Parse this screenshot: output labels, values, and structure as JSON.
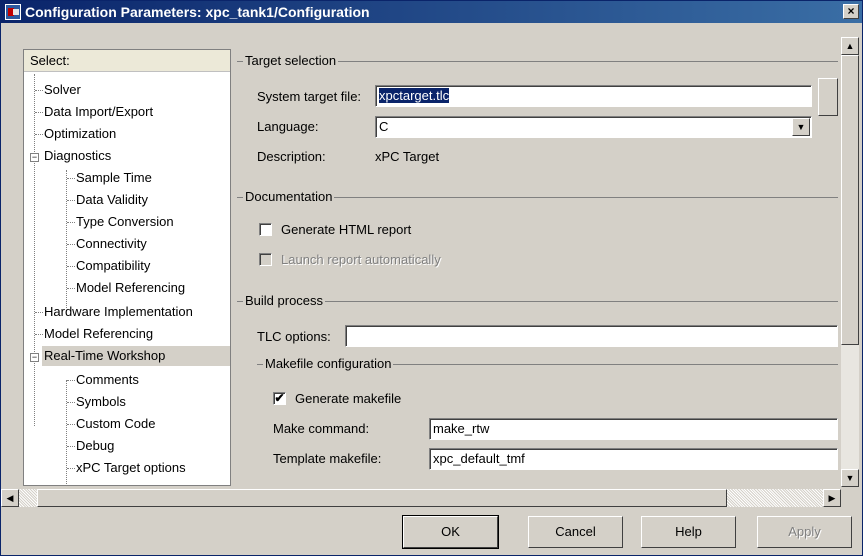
{
  "window": {
    "title": "Configuration Parameters: xpc_tank1/Configuration",
    "close_label": "×"
  },
  "tree": {
    "header": "Select:",
    "items": [
      {
        "label": "Solver"
      },
      {
        "label": "Data Import/Export"
      },
      {
        "label": "Optimization"
      },
      {
        "label": "Diagnostics",
        "expander": "−"
      },
      {
        "label": "Sample Time"
      },
      {
        "label": "Data Validity"
      },
      {
        "label": "Type Conversion"
      },
      {
        "label": "Connectivity"
      },
      {
        "label": "Compatibility"
      },
      {
        "label": "Model Referencing"
      },
      {
        "label": "Hardware Implementation"
      },
      {
        "label": "Model Referencing"
      },
      {
        "label": "Real-Time Workshop",
        "expander": "−",
        "selected": true
      },
      {
        "label": "Comments"
      },
      {
        "label": "Symbols"
      },
      {
        "label": "Custom Code"
      },
      {
        "label": "Debug"
      },
      {
        "label": "xPC Target options"
      }
    ]
  },
  "target_selection": {
    "title": "Target selection",
    "system_target_file_label": "System target file:",
    "system_target_file_value": "xpctarget.tlc",
    "language_label": "Language:",
    "language_value": "C",
    "description_label": "Description:",
    "description_value": "xPC Target"
  },
  "documentation": {
    "title": "Documentation",
    "generate_html_label": "Generate HTML report",
    "generate_html_checked": false,
    "launch_report_label": "Launch report automatically",
    "launch_report_checked": false
  },
  "build_process": {
    "title": "Build process",
    "tlc_options_label": "TLC options:",
    "tlc_options_value": "",
    "makefile": {
      "title": "Makefile configuration",
      "generate_makefile_label": "Generate makefile",
      "generate_makefile_check": "✔",
      "make_command_label": "Make command:",
      "make_command_value": "make_rtw",
      "template_makefile_label": "Template makefile:",
      "template_makefile_value": "xpc_default_tmf"
    }
  },
  "icons": {
    "dropdown": "▼",
    "up": "▲",
    "down": "▼",
    "left": "◀",
    "right": "▶"
  },
  "buttons": {
    "ok": "OK",
    "cancel": "Cancel",
    "help": "Help",
    "apply": "Apply"
  }
}
